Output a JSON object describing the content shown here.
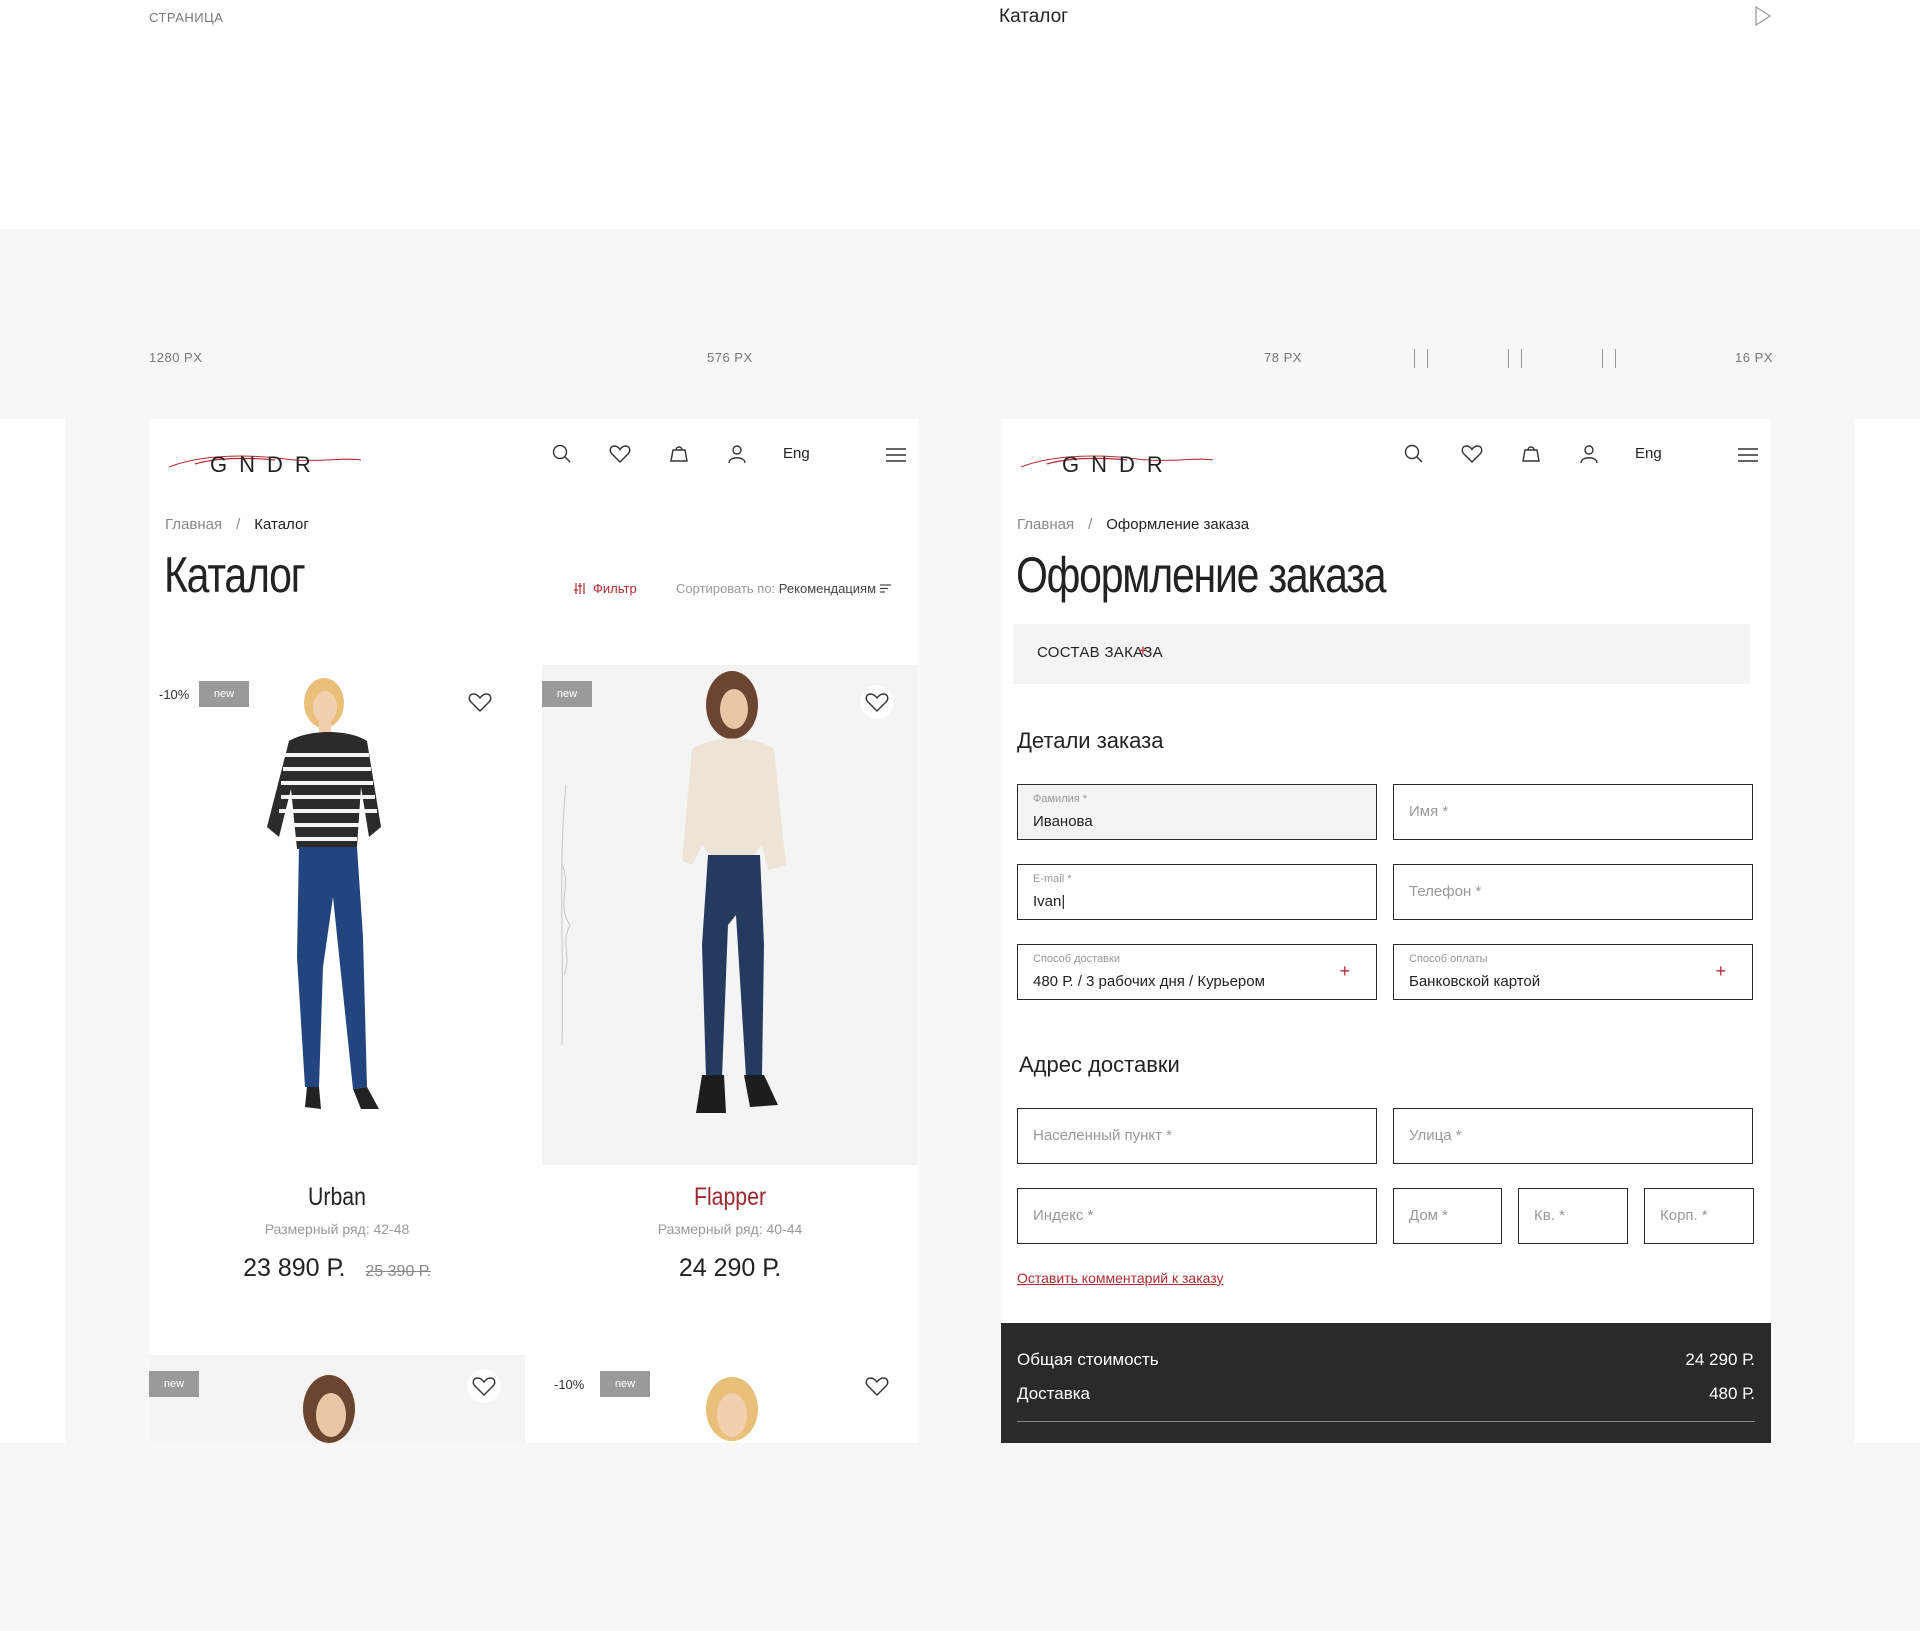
{
  "top": {
    "label": "Страница",
    "title": "Каталог"
  },
  "measures": {
    "w1": "1280 PX",
    "w2": "576 PX",
    "w3": "78 PX",
    "w4": "16 PX"
  },
  "header": {
    "lang": "Eng",
    "logo": "G N D R"
  },
  "catalog": {
    "crumb_home": "Главная",
    "crumb_sep": "/",
    "crumb_current": "Каталог",
    "title": "Каталог",
    "filter": "Фильтр",
    "sort_label": "Сортировать по:",
    "sort_value": "Рекомендациям",
    "products": [
      {
        "name": "Urban",
        "sizes": "Размерный ряд: 42-48",
        "price": "23 890 Р.",
        "old_price": "25 390 Р.",
        "discount": "-10%",
        "badge": "new"
      },
      {
        "name": "Flapper",
        "sizes": "Размерный ряд: 40-44",
        "price": "24 290 Р.",
        "badge": "new"
      },
      {
        "badge": "new"
      },
      {
        "discount": "-10%",
        "badge": "new"
      }
    ]
  },
  "checkout": {
    "crumb_home": "Главная",
    "crumb_sep": "/",
    "crumb_current": "Оформление заказа",
    "title": "Оформление заказа",
    "order_bar": "СОСТАВ ЗАКАЗА",
    "order_plus": "+",
    "details_title": "Детали заказа",
    "fields": {
      "surname_label": "Фамилия *",
      "surname_value": "Иванова",
      "name_ph": "Имя *",
      "email_label": "E-mail *",
      "email_value": "Ivan|",
      "phone_ph": "Телефон *",
      "delivery_label": "Способ доставки",
      "delivery_value": "480 Р. / 3 рабочих дня / Курьером",
      "payment_label": "Способ оплаты",
      "payment_value": "Банковской картой",
      "plus": "+"
    },
    "address_title": "Адрес доставки",
    "address": {
      "city_ph": "Населенный пункт *",
      "street_ph": "Улица *",
      "index_ph": "Индекс *",
      "house_ph": "Дом *",
      "apt_ph": "Кв. *",
      "korp_ph": "Корп. *"
    },
    "comment_link": "Оставить комментарий к заказу",
    "total_label": "Общая стоимость",
    "total_value": "24 290 Р.",
    "delivery_label": "Доставка",
    "delivery_value": "480 Р."
  },
  "colors": {
    "accent": "#b22a32",
    "dark": "#2a2a2a",
    "badge": "#9a9a9a"
  }
}
